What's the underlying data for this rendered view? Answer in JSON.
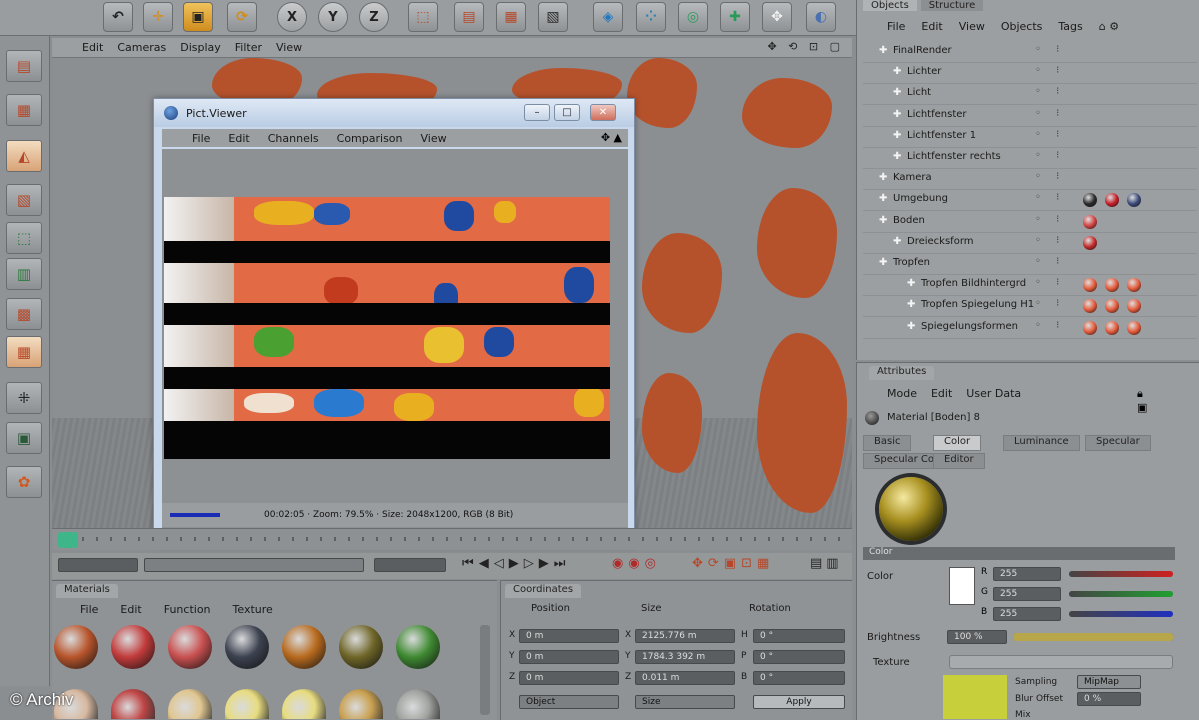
{
  "top_toolbar": {
    "buttons": [
      {
        "icon": "undo-icon",
        "label": ""
      },
      {
        "icon": "move-icon",
        "label": ""
      },
      {
        "icon": "scale-icon",
        "label": ""
      },
      {
        "icon": "rotate-icon",
        "label": ""
      },
      {
        "icon": "x-axis-icon",
        "label": "X"
      },
      {
        "icon": "y-axis-icon",
        "label": "Y"
      },
      {
        "icon": "z-axis-icon",
        "label": "Z"
      },
      {
        "icon": "world-coords-icon",
        "label": ""
      },
      {
        "icon": "render-view-icon",
        "label": ""
      },
      {
        "icon": "render-picture-viewer-icon",
        "label": ""
      },
      {
        "icon": "render-settings-icon",
        "label": ""
      },
      {
        "icon": "cube-icon",
        "label": ""
      },
      {
        "icon": "spline-icon",
        "label": ""
      },
      {
        "icon": "nurbs-icon",
        "label": ""
      },
      {
        "icon": "array-icon",
        "label": ""
      },
      {
        "icon": "deformer-icon",
        "label": ""
      },
      {
        "icon": "scene-icon",
        "label": ""
      }
    ]
  },
  "viewport": {
    "menu": [
      "Edit",
      "Cameras",
      "Display",
      "Filter",
      "View"
    ],
    "nav_icons": "✥ ⟲ ⊡ ▢"
  },
  "picture_viewer": {
    "title": "Pict.Viewer",
    "menu": [
      "File",
      "Edit",
      "Channels",
      "Comparison",
      "View"
    ],
    "status_text": "00:02:05 · Zoom: 79.5% · Size: 2048x1200, RGB (8 Bit)",
    "window_buttons": [
      "–",
      "□",
      "✕"
    ]
  },
  "materials_panel": {
    "title": "Materials",
    "menu": [
      "File",
      "Edit",
      "Function",
      "Texture"
    ],
    "sphere_colors": [
      "#b8552c",
      "#c23b3b",
      "#c95050",
      "#3c4250",
      "#b86a1e",
      "#6f6628",
      "#3f8a32"
    ]
  },
  "coordinates_panel": {
    "title": "Coordinates",
    "headers": [
      "Position",
      "Size",
      "Rotation"
    ],
    "rows": [
      {
        "axis": "X",
        "pos": "0 m",
        "size_axis": "X",
        "size": "2125.776 m",
        "rot_axis": "H",
        "rot": "0 °"
      },
      {
        "axis": "Y",
        "pos": "0 m",
        "size_axis": "Y",
        "size": "1784.3 392 m",
        "rot_axis": "P",
        "rot": "0 °"
      },
      {
        "axis": "Z",
        "pos": "0 m",
        "size_axis": "Z",
        "size": "0.011 m",
        "rot_axis": "B",
        "rot": "0 °"
      }
    ],
    "mode_dropdown": "Object",
    "size_dropdown": "Size",
    "apply_label": "Apply"
  },
  "objects_panel": {
    "tabs": [
      "Objects",
      "Structure"
    ],
    "menu": [
      "File",
      "Edit",
      "View",
      "Objects",
      "Tags"
    ],
    "rows": [
      {
        "name": "FinalRender",
        "indent": 0,
        "tags": []
      },
      {
        "name": "Lichter",
        "indent": 1,
        "tags": []
      },
      {
        "name": "Licht",
        "indent": 1,
        "tags": []
      },
      {
        "name": "Lichtfenster",
        "indent": 1,
        "tags": []
      },
      {
        "name": "Lichtfenster 1",
        "indent": 1,
        "tags": []
      },
      {
        "name": "Lichtfenster rechts",
        "indent": 1,
        "tags": []
      },
      {
        "name": "Kamera",
        "indent": 0,
        "tags": []
      },
      {
        "name": "Umgebung",
        "indent": 0,
        "tags": [
          "#2a2a2a",
          "#c41f2b",
          "#3b4a7a"
        ]
      },
      {
        "name": "Boden",
        "indent": 0,
        "tags": [
          "#d34242"
        ]
      },
      {
        "name": "Dreiecksform",
        "indent": 1,
        "tags": [
          "#c22a2a"
        ]
      },
      {
        "name": "Tropfen",
        "indent": 0,
        "tags": []
      },
      {
        "name": "Tropfen Bildhintergrd",
        "indent": 2,
        "tags": [
          "#e35a3a",
          "#e35a3a",
          "#e35a3a"
        ]
      },
      {
        "name": "Tropfen Spiegelung H1",
        "indent": 2,
        "tags": [
          "#e35a3a",
          "#e35a3a",
          "#e35a3a"
        ]
      },
      {
        "name": "Spiegelungsformen",
        "indent": 2,
        "tags": [
          "#e35a3a",
          "#e35a3a",
          "#e35a3a"
        ]
      }
    ]
  },
  "attributes_panel": {
    "title": "Attributes",
    "menu": [
      "Mode",
      "Edit",
      "User Data"
    ],
    "material_name": "Material [Boden] 8",
    "tabs_row1": [
      "Basic",
      "Color",
      "Luminance",
      "Specular"
    ],
    "tabs_row2": [
      "Specular Color",
      "Editor"
    ],
    "active_tab": "Color",
    "section_title": "Color",
    "color_label": "Color",
    "channels": [
      {
        "label": "R",
        "value": "255",
        "fill": 1.0,
        "color": "#d02020"
      },
      {
        "label": "G",
        "value": "255",
        "fill": 1.0,
        "color": "#20a030"
      },
      {
        "label": "B",
        "value": "255",
        "fill": 1.0,
        "color": "#2030c0"
      }
    ],
    "brightness_label": "Brightness",
    "brightness_value": "100 %",
    "texture_label": "Texture",
    "sampling_label": "Sampling",
    "sampling_value": "MipMap",
    "blur_offset_label": "Blur Offset",
    "blur_offset_value": "0 %",
    "mix_label": "Mix"
  },
  "copyright": "© Archiv"
}
